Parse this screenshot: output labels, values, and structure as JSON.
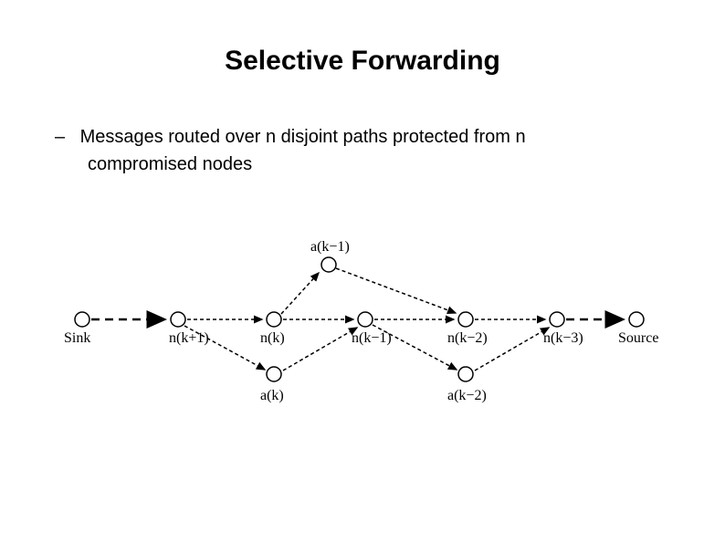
{
  "title": "Selective Forwarding",
  "bullet": {
    "line1": "Messages routed over n  disjoint paths protected from n",
    "line2": "compromised nodes"
  },
  "labels": {
    "sink": "Sink",
    "source": "Source",
    "n_k1": "n(k+1)",
    "n_k": "n(k)",
    "n_km1": "n(k−1)",
    "n_km2": "n(k−2)",
    "n_km3": "n(k−3)",
    "a_km1": "a(k−1)",
    "a_k": "a(k)",
    "a_km2": "a(k−2)"
  }
}
